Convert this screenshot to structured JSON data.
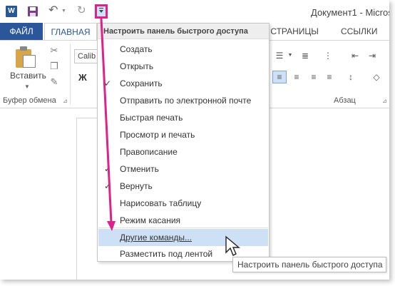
{
  "app": {
    "title": "Документ1 - Micros",
    "word_icon_letter": "W"
  },
  "tabs": {
    "file": "ФАЙЛ",
    "home": "ГЛАВНАЯ",
    "page_layout": "А СТРАНИЦЫ",
    "references": "ССЫЛКИ"
  },
  "ribbon": {
    "paste_label": "Вставить",
    "clipboard_group": "Буфер обмена",
    "font_name": "Calib",
    "bold": "Ж",
    "paragraph_group": "Абзац"
  },
  "menu": {
    "header": "Настроить панель быстрого доступа",
    "items": [
      {
        "label": "Создать",
        "checked": false
      },
      {
        "label": "Открыть",
        "checked": false
      },
      {
        "label": "Сохранить",
        "checked": true
      },
      {
        "label": "Отправить по электронной почте",
        "checked": false
      },
      {
        "label": "Быстрая печать",
        "checked": false
      },
      {
        "label": "Просмотр и печать",
        "checked": false
      },
      {
        "label": "Правописание",
        "checked": false
      },
      {
        "label": "Отменить",
        "checked": true
      },
      {
        "label": "Вернуть",
        "checked": true
      },
      {
        "label": "Нарисовать таблицу",
        "checked": false
      },
      {
        "label": "Режим касания",
        "checked": false
      }
    ],
    "more_commands": "Другие команды...",
    "place_below": "Разместить под лентой"
  },
  "tooltip": "Настроить панель быстрого доступа",
  "colors": {
    "accent": "#2b579a",
    "highlight": "#cde0f5",
    "annotation": "#e0218a"
  }
}
